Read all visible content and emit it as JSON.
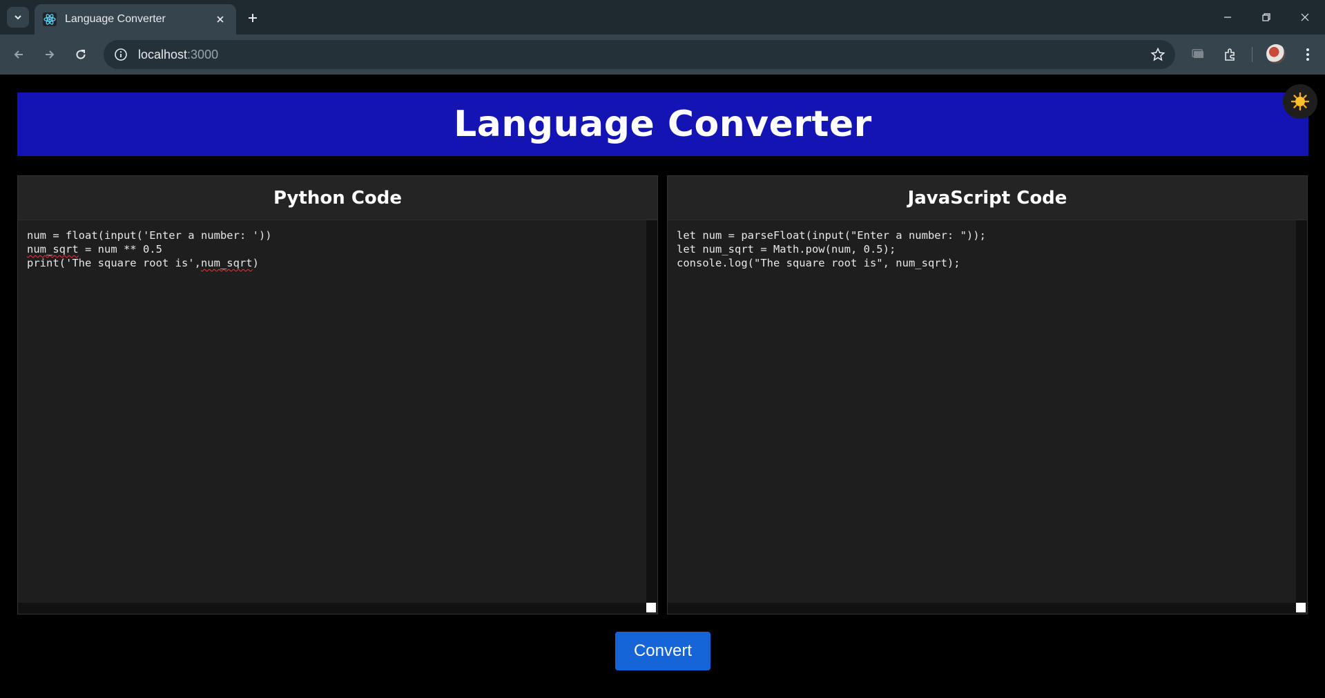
{
  "browser": {
    "tab_title": "Language Converter",
    "url_host": "localhost",
    "url_port": ":3000"
  },
  "app": {
    "title": "Language Converter",
    "theme_icon": "sun-icon"
  },
  "panels": {
    "python": {
      "heading": "Python Code",
      "code_lines": [
        "num = float(input('Enter a number: '))",
        "num_sqrt = num ** 0.5",
        "print('The square root is',num_sqrt)"
      ],
      "spellcheck_words": [
        "num_sqrt"
      ]
    },
    "javascript": {
      "heading": "JavaScript Code",
      "code_lines": [
        "let num = parseFloat(input(\"Enter a number: \"));",
        "let num_sqrt = Math.pow(num, 0.5);",
        "console.log(\"The square root is\", num_sqrt);"
      ]
    }
  },
  "actions": {
    "convert_label": "Convert"
  },
  "colors": {
    "header_bg": "#1414b4",
    "button_bg": "#1565d8",
    "panel_bg": "#1e1e1f"
  }
}
